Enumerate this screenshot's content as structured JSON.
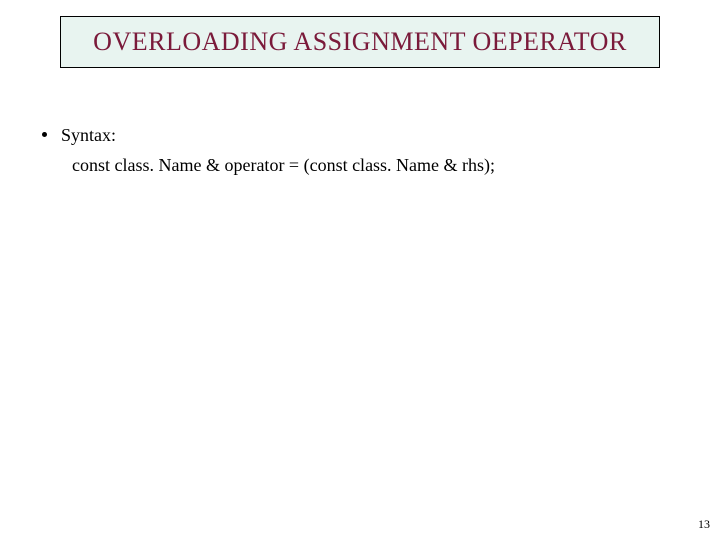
{
  "title": "OVERLOADING ASSIGNMENT OEPERATOR",
  "bullet": {
    "label": "Syntax:",
    "line": "const class. Name & operator = (const class. Name & rhs);"
  },
  "page_number": "13"
}
